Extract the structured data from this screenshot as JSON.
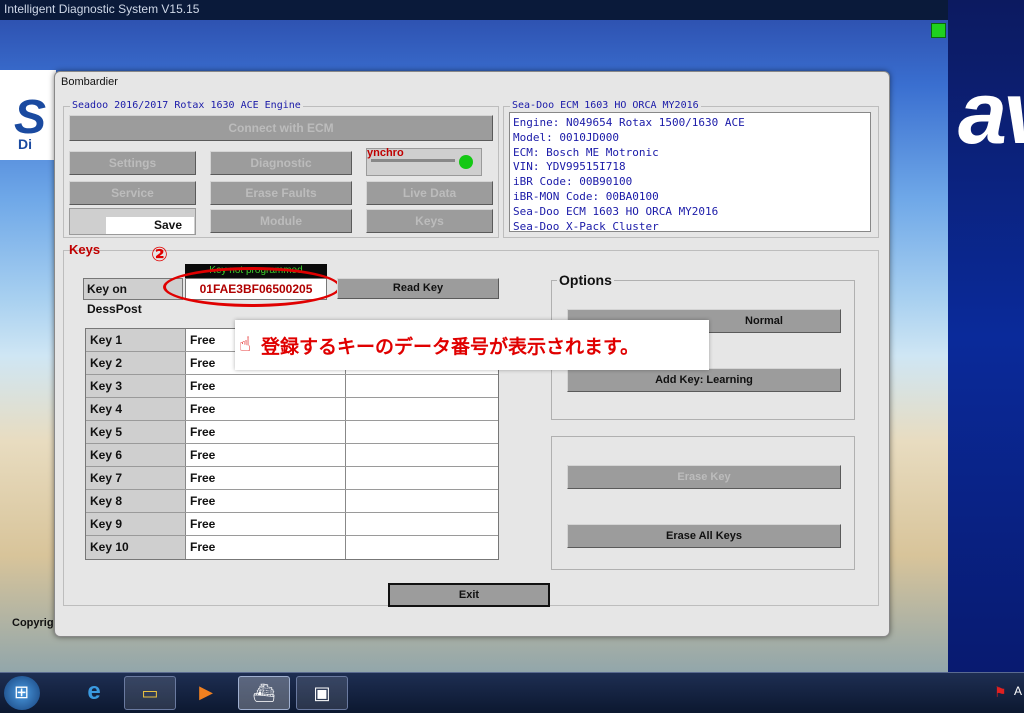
{
  "app": {
    "title": "Intelligent Diagnostic System V15.15",
    "dialog_title": "Bombardier",
    "copyright": "Copyrig",
    "brand_fragment": "av"
  },
  "engine_group": {
    "title": "Seadoo 2016/2017 Rotax 1630 ACE Engine",
    "connect_label": "Connect with ECM",
    "settings_label": "Settings",
    "diagnostic_label": "Diagnostic",
    "synchro_label": "ynchro",
    "service_label": "Service",
    "erase_faults_label": "Erase Faults",
    "live_data_label": "Live Data",
    "save_label": "Save",
    "module_label": "Module",
    "keys_label": "Keys"
  },
  "ecm_group": {
    "title": "Sea-Doo ECM 1603 HO ORCA MY2016",
    "lines": [
      "Engine: N049654 Rotax 1500/1630 ACE",
      "Model: 0010JD000",
      "ECM: Bosch ME Motronic",
      "VIN: YDV99515I718",
      "iBR Code: 00B90100",
      "iBR-MON Code: 00BA0100",
      "Sea-Doo ECM 1603 HO ORCA MY2016",
      "Sea-Doo X-Pack  Cluster"
    ]
  },
  "keys": {
    "section_label": "Keys",
    "step_marker": "②",
    "status_text": "Key not programmed",
    "key_on_label": "Key on DessPost",
    "key_on_value": "01FAE3BF06500205",
    "read_key_label": "Read Key",
    "rows": [
      {
        "name": "Key 1",
        "status": "Free"
      },
      {
        "name": "Key 2",
        "status": "Free"
      },
      {
        "name": "Key 3",
        "status": "Free"
      },
      {
        "name": "Key 4",
        "status": "Free"
      },
      {
        "name": "Key 5",
        "status": "Free"
      },
      {
        "name": "Key 6",
        "status": "Free"
      },
      {
        "name": "Key 7",
        "status": "Free"
      },
      {
        "name": "Key 8",
        "status": "Free"
      },
      {
        "name": "Key 9",
        "status": "Free"
      },
      {
        "name": "Key 10",
        "status": "Free"
      }
    ]
  },
  "annotation": {
    "text": "登録するキーのデータ番号が表示されます。"
  },
  "options": {
    "title": "Options",
    "add_normal_label": "Normal",
    "add_learning_label": "Add Key: Learning",
    "erase_key_label": "Erase Key",
    "erase_all_label": "Erase All Keys"
  },
  "exit_label": "Exit",
  "colors": {
    "accent_red": "#e00000",
    "ecm_text_blue": "#1a1aa8",
    "status_green": "#3cd02c",
    "button_gray": "#9c9c9c"
  }
}
